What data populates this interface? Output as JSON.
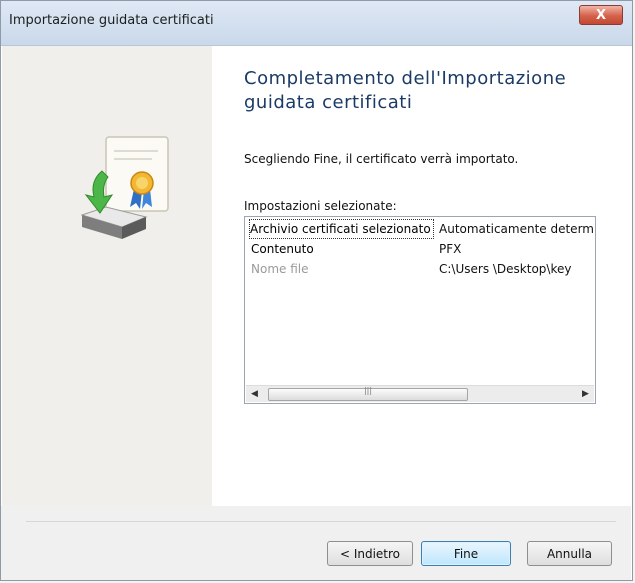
{
  "window": {
    "title": "Importazione guidata certificati",
    "close_glyph": "X"
  },
  "main": {
    "heading": "Completamento dell'Importazione guidata certificati",
    "intro": "Scegliendo Fine, il certificato verrà importato.",
    "settings_label": "Impostazioni selezionate:",
    "settings": [
      {
        "name": "Archivio certificati selezionato",
        "value": "Automaticamente determinato"
      },
      {
        "name": "Contenuto",
        "value": "PFX"
      },
      {
        "name": "Nome file",
        "value": "C:\\Users \\Desktop\\key"
      }
    ],
    "scroll_left": "◀",
    "scroll_right": "▶",
    "scroll_grip": "|||"
  },
  "buttons": {
    "back": "< Indietro",
    "finish": "Fine",
    "cancel": "Annulla"
  },
  "icons": {
    "wizard": "certificate-import-icon",
    "close": "close-icon"
  }
}
